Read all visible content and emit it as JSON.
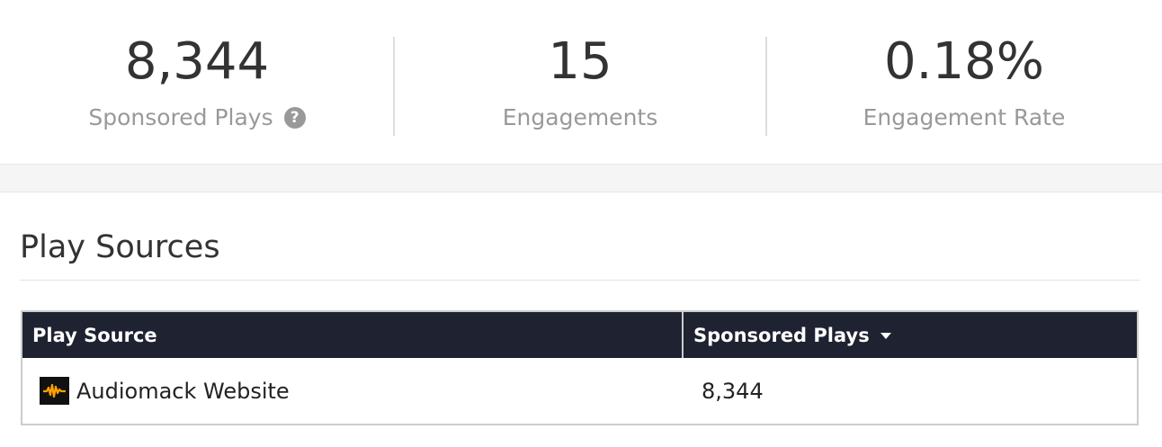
{
  "stats": [
    {
      "value": "8,344",
      "label": "Sponsored Plays",
      "has_help": true
    },
    {
      "value": "15",
      "label": "Engagements"
    },
    {
      "value": "0.18%",
      "label": "Engagement Rate"
    }
  ],
  "help_icon": "question-circle-icon",
  "section": {
    "title": "Play Sources"
  },
  "table": {
    "columns": [
      "Play Source",
      "Sponsored Plays"
    ],
    "sort_icon": "caret-down-icon",
    "rows": [
      {
        "source": "Audiomack Website",
        "icon": "audiomack-logo-icon",
        "plays": "8,344"
      }
    ]
  },
  "colors": {
    "header_bg": "#1f2230",
    "logo_orange": "#ffa200",
    "muted_text": "#999999"
  }
}
